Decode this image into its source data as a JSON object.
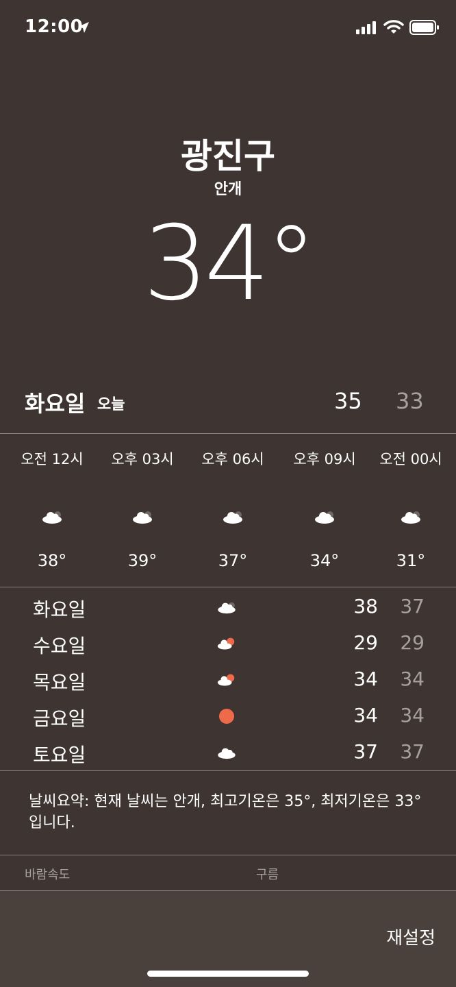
{
  "status": {
    "time": "12:00"
  },
  "header": {
    "city": "광진구",
    "condition": "안개",
    "temperature": "34°"
  },
  "today": {
    "day": "화요일",
    "label": "오늘",
    "high": "35",
    "low": "33"
  },
  "hourly": [
    {
      "time": "오전 12시",
      "icon": "cloud-icon",
      "temp": "38°"
    },
    {
      "time": "오후 03시",
      "icon": "cloud-icon",
      "temp": "39°"
    },
    {
      "time": "오후 06시",
      "icon": "cloud-icon",
      "temp": "37°"
    },
    {
      "time": "오후 09시",
      "icon": "cloud-icon",
      "temp": "34°"
    },
    {
      "time": "오전 00시",
      "icon": "cloud-icon",
      "temp": "31°"
    }
  ],
  "daily": [
    {
      "day": "화요일",
      "icon": "cloud-icon",
      "high": "38",
      "low": "37"
    },
    {
      "day": "수요일",
      "icon": "cloud-sun-icon",
      "high": "29",
      "low": "29"
    },
    {
      "day": "목요일",
      "icon": "cloud-sun-icon",
      "high": "34",
      "low": "34"
    },
    {
      "day": "금요일",
      "icon": "sun-icon",
      "high": "34",
      "low": "34"
    },
    {
      "day": "토요일",
      "icon": "cloud-icon",
      "high": "37",
      "low": "37"
    }
  ],
  "summary": "날씨요약: 현재 날씨는 안개, 최고기온은 35°, 최저기온은 33°입니다.",
  "details": {
    "wind_label": "바람속도",
    "cloud_label": "구름"
  },
  "footer": {
    "reset_label": "재설정"
  },
  "colors": {
    "background": "#3e3532",
    "secondary_text": "#a8a09c",
    "sun": "#ef6a4a"
  }
}
